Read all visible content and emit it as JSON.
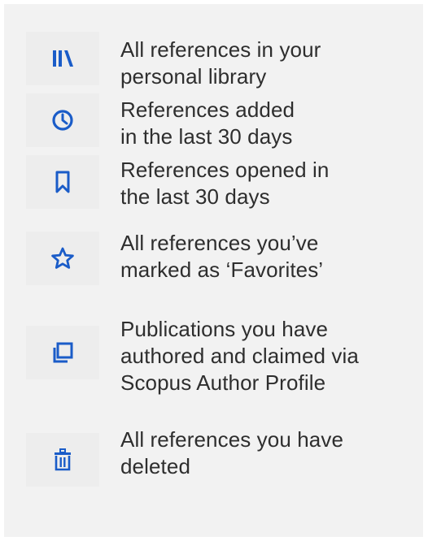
{
  "colors": {
    "panel_background": "#f2f2f2",
    "icon_tile_background": "#ededed",
    "icon_color": "#1a5cc8",
    "text_color": "#2e2e2e"
  },
  "items": [
    {
      "icon": "library-icon",
      "label": "All references in your\npersonal library"
    },
    {
      "icon": "clock-icon",
      "label": "References added\nin the last 30 days"
    },
    {
      "icon": "bookmark-icon",
      "label": "References opened in\nthe last 30 days"
    },
    {
      "icon": "star-icon",
      "label": "All references you’ve\nmarked as ‘Favorites’"
    },
    {
      "icon": "documents-icon",
      "label": "Publications you have\nauthored and claimed via\nScopus Author Profile"
    },
    {
      "icon": "trash-icon",
      "label": "All references you have\ndeleted"
    }
  ]
}
